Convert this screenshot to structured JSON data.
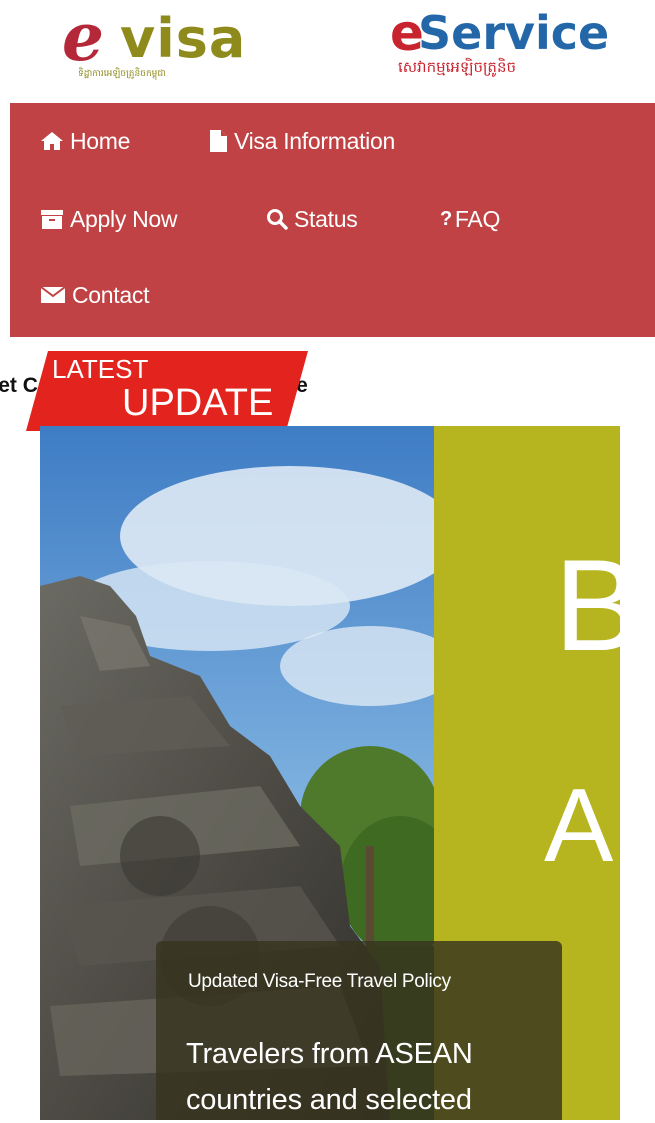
{
  "header": {
    "evisa_logo": {
      "e": "e",
      "word": "visa",
      "tagline": "ទិដ្ឋាការអេឡិចត្រូនិចកម្ពុជា"
    },
    "eservice_logo": {
      "e": "e",
      "word": "Service",
      "tagline": "សេវាកម្មអេឡិចត្រូនិច"
    }
  },
  "nav": {
    "items": [
      {
        "label": "Home",
        "icon": "home-icon"
      },
      {
        "label": "Visa Information",
        "icon": "document-icon"
      },
      {
        "label": "Apply Now",
        "icon": "archive-icon"
      },
      {
        "label": "Status",
        "icon": "search-icon"
      },
      {
        "label": "FAQ",
        "icon": "question-icon"
      },
      {
        "label": "Contact",
        "icon": "envelope-icon"
      }
    ]
  },
  "ticker": {
    "badge_top": "LATEST",
    "badge_bottom": "UPDATE",
    "text": "Official site for tourists to get Cambodia visa. Apply online"
  },
  "hero": {
    "panel_letter_1": "B",
    "panel_letter_2": "A",
    "caption_title": "Updated Visa-Free Travel Policy",
    "caption_body": "Travelers from ASEAN countries and selected"
  },
  "colors": {
    "nav_bg": "#c14244",
    "badge_red": "#e3241e",
    "panel_olive": "#b6b51f",
    "evisa_red": "#b5283a",
    "evisa_olive": "#8e8a1c",
    "eservice_blue": "#2367a8"
  }
}
